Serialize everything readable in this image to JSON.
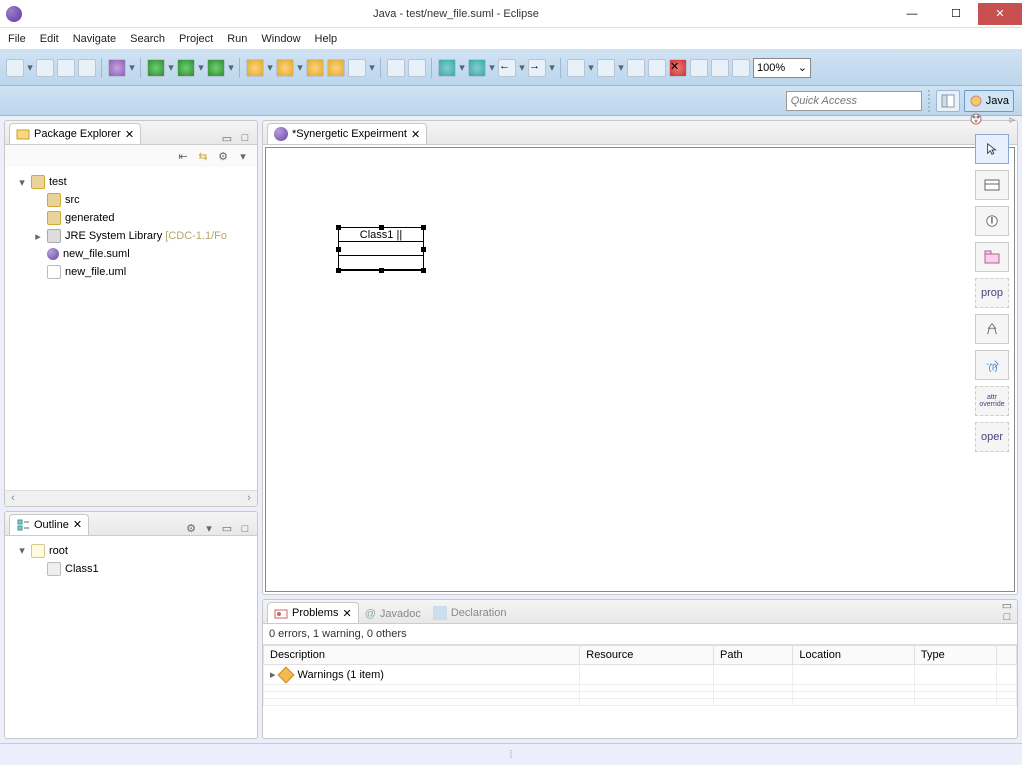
{
  "window": {
    "title": "Java - test/new_file.suml - Eclipse"
  },
  "menu": [
    "File",
    "Edit",
    "Navigate",
    "Search",
    "Project",
    "Run",
    "Window",
    "Help"
  ],
  "toolbar": {
    "zoom": "100%"
  },
  "quick_access_placeholder": "Quick Access",
  "perspective": {
    "active": "Java"
  },
  "package_explorer": {
    "title": "Package Explorer",
    "items": [
      {
        "depth": 0,
        "expander": "▾",
        "icon": "pkg",
        "label": "test"
      },
      {
        "depth": 1,
        "expander": "",
        "icon": "pkg",
        "label": "src"
      },
      {
        "depth": 1,
        "expander": "",
        "icon": "pkg",
        "label": "generated"
      },
      {
        "depth": 1,
        "expander": "▸",
        "icon": "lib",
        "label": "JRE System Library",
        "suffix": "[CDC-1.1/Fo"
      },
      {
        "depth": 1,
        "expander": "",
        "icon": "file",
        "label": "new_file.suml"
      },
      {
        "depth": 1,
        "expander": "",
        "icon": "filex",
        "label": "new_file.uml"
      }
    ]
  },
  "outline": {
    "title": "Outline",
    "items": [
      {
        "depth": 0,
        "expander": "▾",
        "icon": "root",
        "label": "root"
      },
      {
        "depth": 1,
        "expander": "",
        "icon": "cls",
        "label": "Class1"
      }
    ]
  },
  "editor": {
    "tab": "*Synergetic Expeirment",
    "uml_class_name": "Class1 ||"
  },
  "palette": {
    "items": [
      "",
      "",
      "",
      "",
      "prop",
      "",
      "",
      "attr override",
      "oper"
    ]
  },
  "problems": {
    "tabs": [
      "Problems",
      "Javadoc",
      "Declaration"
    ],
    "summary": "0 errors, 1 warning, 0 others",
    "columns": [
      "Description",
      "Resource",
      "Path",
      "Location",
      "Type"
    ],
    "rows": [
      {
        "desc": "Warnings (1 item)"
      }
    ]
  }
}
